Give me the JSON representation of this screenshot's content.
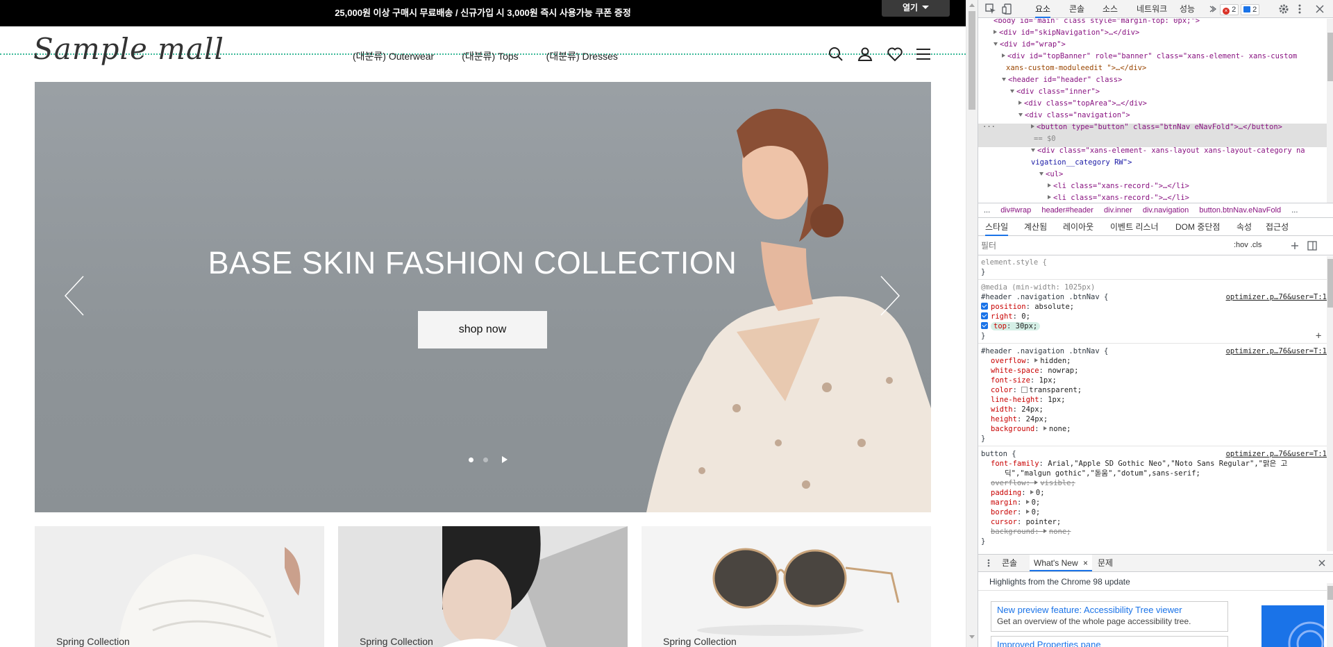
{
  "site": {
    "banner_text": "25,000원 이상 구매시 무료배송 / 신규가입 시 3,000원 즉시 사용가능 쿠폰 증정",
    "open_label": "열기",
    "logo_text": "Sample mall",
    "nav": [
      "(대분류) Outerwear",
      "(대분류) Tops",
      "(대분류) Dresses"
    ],
    "hero_title": "BASE SKIN FASHION COLLECTION",
    "hero_button": "shop now",
    "cards": [
      "Spring Collection",
      "Spring Collection",
      "Spring Collection"
    ],
    "colors": {
      "banner": "#000000",
      "accent_dotline": "#3cb999",
      "hero_bg": "#92989c"
    }
  },
  "devtools": {
    "tabs": [
      "요소",
      "콘솔",
      "소스",
      "네트워크",
      "성능"
    ],
    "error_count": "2",
    "message_count": "2",
    "elements": [
      "<body id=\"main\" class style=\"margin-top: 0px;\">",
      "<div id=\"skipNavigation\">…</div>",
      "<div id=\"wrap\">",
      "<div id=\"topBanner\" role=\"banner\" class=\"xans-element- xans-custom",
      "xans-custom-moduleedit \">…</div>",
      "<header id=\"header\" class>",
      "<div class=\"inner\">",
      "<div class=\"topArea\">…</div>",
      "<div class=\"navigation\">",
      "<button type=\"button\" class=\"btnNav eNavFold\">…</button>",
      "== $0",
      "<div class=\"xans-element- xans-layout xans-layout-category na",
      "vigation__category RW\">",
      "<ul>",
      "<li class=\"xans-record-\">…</li>",
      "<li class=\"xans-record-\">…</li>"
    ],
    "breadcrumb": [
      "...",
      "div#wrap",
      "header#header",
      "div.inner",
      "div.navigation",
      "button.btnNav.eNavFold",
      "..."
    ],
    "style_tabs": [
      "스타일",
      "계산됨",
      "레이아웃",
      "이벤트 리스너",
      "DOM 중단점",
      "속성",
      "접근성"
    ],
    "filter_placeholder": "필터",
    "filter_tools": ":hov .cls",
    "styles": {
      "element_style": "element.style {",
      "close": "}",
      "media": "@media (min-width: 1025px)",
      "rule1_selector": "#header .navigation .btnNav {",
      "rule1_source": "optimizer.p…76&user=T:1",
      "rule1_props": [
        {
          "p": "position",
          "v": "absolute;"
        },
        {
          "p": "right",
          "v": "0;"
        },
        {
          "p": "top",
          "v": "30px;"
        }
      ],
      "rule2_selector": "#header .navigation .btnNav {",
      "rule2_source": "optimizer.p…76&user=T:1",
      "rule2_props": [
        {
          "p": "overflow",
          "v": "hidden;"
        },
        {
          "p": "white-space",
          "v": "nowrap;"
        },
        {
          "p": "font-size",
          "v": "1px;"
        },
        {
          "p": "color",
          "v": "transparent;"
        },
        {
          "p": "line-height",
          "v": "1px;"
        },
        {
          "p": "width",
          "v": "24px;"
        },
        {
          "p": "height",
          "v": "24px;"
        },
        {
          "p": "background",
          "v": "none;"
        }
      ],
      "rule3_selector": "button {",
      "rule3_source": "optimizer.p…76&user=T:1",
      "rule3_font_family": "Arial,\"Apple SD Gothic Neo\",\"Noto Sans Regular\",\"맑은 고",
      "rule3_font_family_cont": "딕\",\"malgun gothic\",\"돋움\",\"dotum\",sans-serif;",
      "rule3_props": [
        {
          "p": "overflow",
          "v": "visible;",
          "struck": true
        },
        {
          "p": "padding",
          "v": "0;"
        },
        {
          "p": "margin",
          "v": "0;"
        },
        {
          "p": "border",
          "v": "0;"
        },
        {
          "p": "cursor",
          "v": "pointer;"
        },
        {
          "p": "background",
          "v": "none;",
          "struck": true
        }
      ]
    },
    "drawer_tabs": [
      "콘솔",
      "What's New",
      "문제"
    ],
    "whatsnew_heading": "Highlights from the Chrome 98 update",
    "whatsnew_cards": [
      {
        "title": "New preview feature: Accessibility Tree viewer",
        "desc": "Get an overview of the whole page accessibility tree."
      },
      {
        "title": "Improved Properties pane",
        "desc": ""
      }
    ]
  }
}
